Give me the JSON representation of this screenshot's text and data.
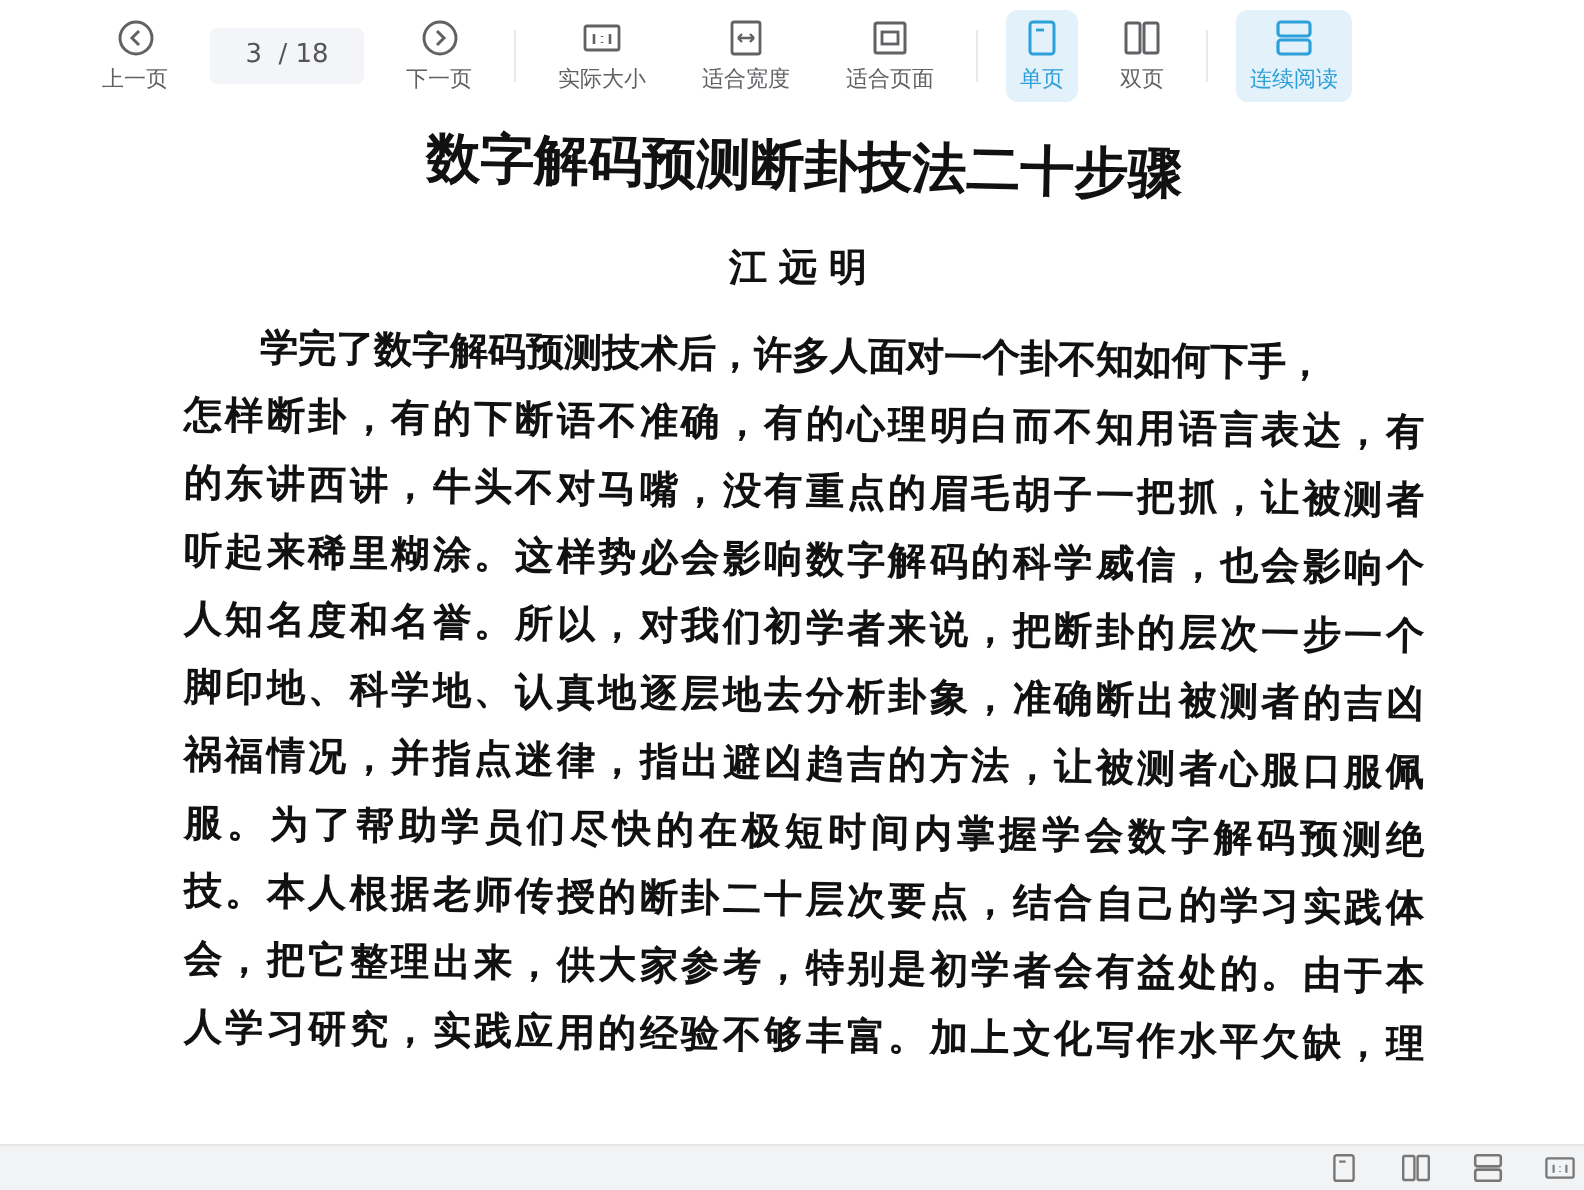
{
  "toolbar": {
    "groups": [
      [
        {
          "kind": "prev",
          "label": "上一页"
        },
        {
          "kind": "page",
          "value": "3",
          "total": "/ 18"
        },
        {
          "kind": "next",
          "label": "下一页"
        }
      ],
      [
        {
          "kind": "actual-size",
          "label": "实际大小"
        },
        {
          "kind": "fit-width",
          "label": "适合宽度"
        },
        {
          "kind": "fit-page",
          "label": "适合页面"
        }
      ],
      [
        {
          "kind": "single",
          "label": "单页",
          "selected": true
        },
        {
          "kind": "double",
          "label": "双页",
          "selected": false
        }
      ],
      [
        {
          "kind": "continuous",
          "label": "连续阅读",
          "selected": true
        }
      ]
    ]
  },
  "document": {
    "title": "数字解码预测断卦技法二十步骤",
    "author": "江远明",
    "lines": [
      "学完了数字解码预测技术后，许多人面对一个卦不知如何下手，",
      "怎样断卦，有的下断语不准确，有的心理明白而不知用语言表达，有",
      "的东讲西讲，牛头不对马嘴，没有重点的眉毛胡子一把抓，让被测者",
      "听起来稀里糊涂。这样势必会影响数字解码的科学威信，也会影响个",
      "人知名度和名誉。所以，对我们初学者来说，把断卦的层次一步一个",
      "脚印地、科学地、认真地逐层地去分析卦象，准确断出被测者的吉凶",
      "祸福情况，并指点迷律，指出避凶趋吉的方法，让被测者心服口服佩",
      "服。为了帮助学员们尽快的在极短时间内掌握学会数字解码预测绝",
      "技。本人根据老师传授的断卦二十层次要点，结合自己的学习实践体",
      "会，把它整理出来，供大家参考，特别是初学者会有益处的。由于本",
      "人学习研究，实践应用的经验不够丰富。加上文化写作水平欠缺，理"
    ]
  },
  "status_bar": {
    "buttons": [
      {
        "kind": "single"
      },
      {
        "kind": "double"
      },
      {
        "kind": "continuous"
      },
      {
        "kind": "actual-size"
      }
    ]
  }
}
